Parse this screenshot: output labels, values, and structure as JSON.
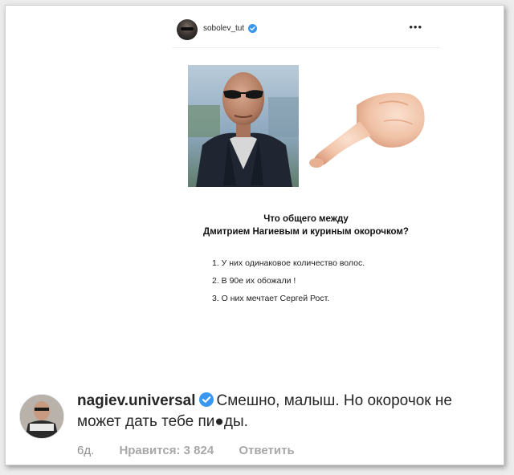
{
  "post": {
    "username": "sobolev_tut",
    "more_icon": "•••",
    "question_line1": "Что общего между",
    "question_line2": "Дмитрием Нагиевым и куриным окорочком?",
    "facts": [
      "1. У них одинаковое количество волос.",
      "2. В 90е их обожали !",
      "3. О них мечтает Сергей Рост."
    ]
  },
  "comment": {
    "username": "nagiev.universal",
    "text": "Смешно, малыш. Но окорочок не может дать тебе пи●ды.",
    "age": "6д.",
    "likes": "Нравится: 3 824",
    "reply": "Ответить"
  },
  "colors": {
    "verified": "#3897f0",
    "text": "#262626",
    "meta": "#8e8e8e"
  },
  "icons": {
    "verified": "verified-badge-icon",
    "more": "more-options-icon"
  }
}
